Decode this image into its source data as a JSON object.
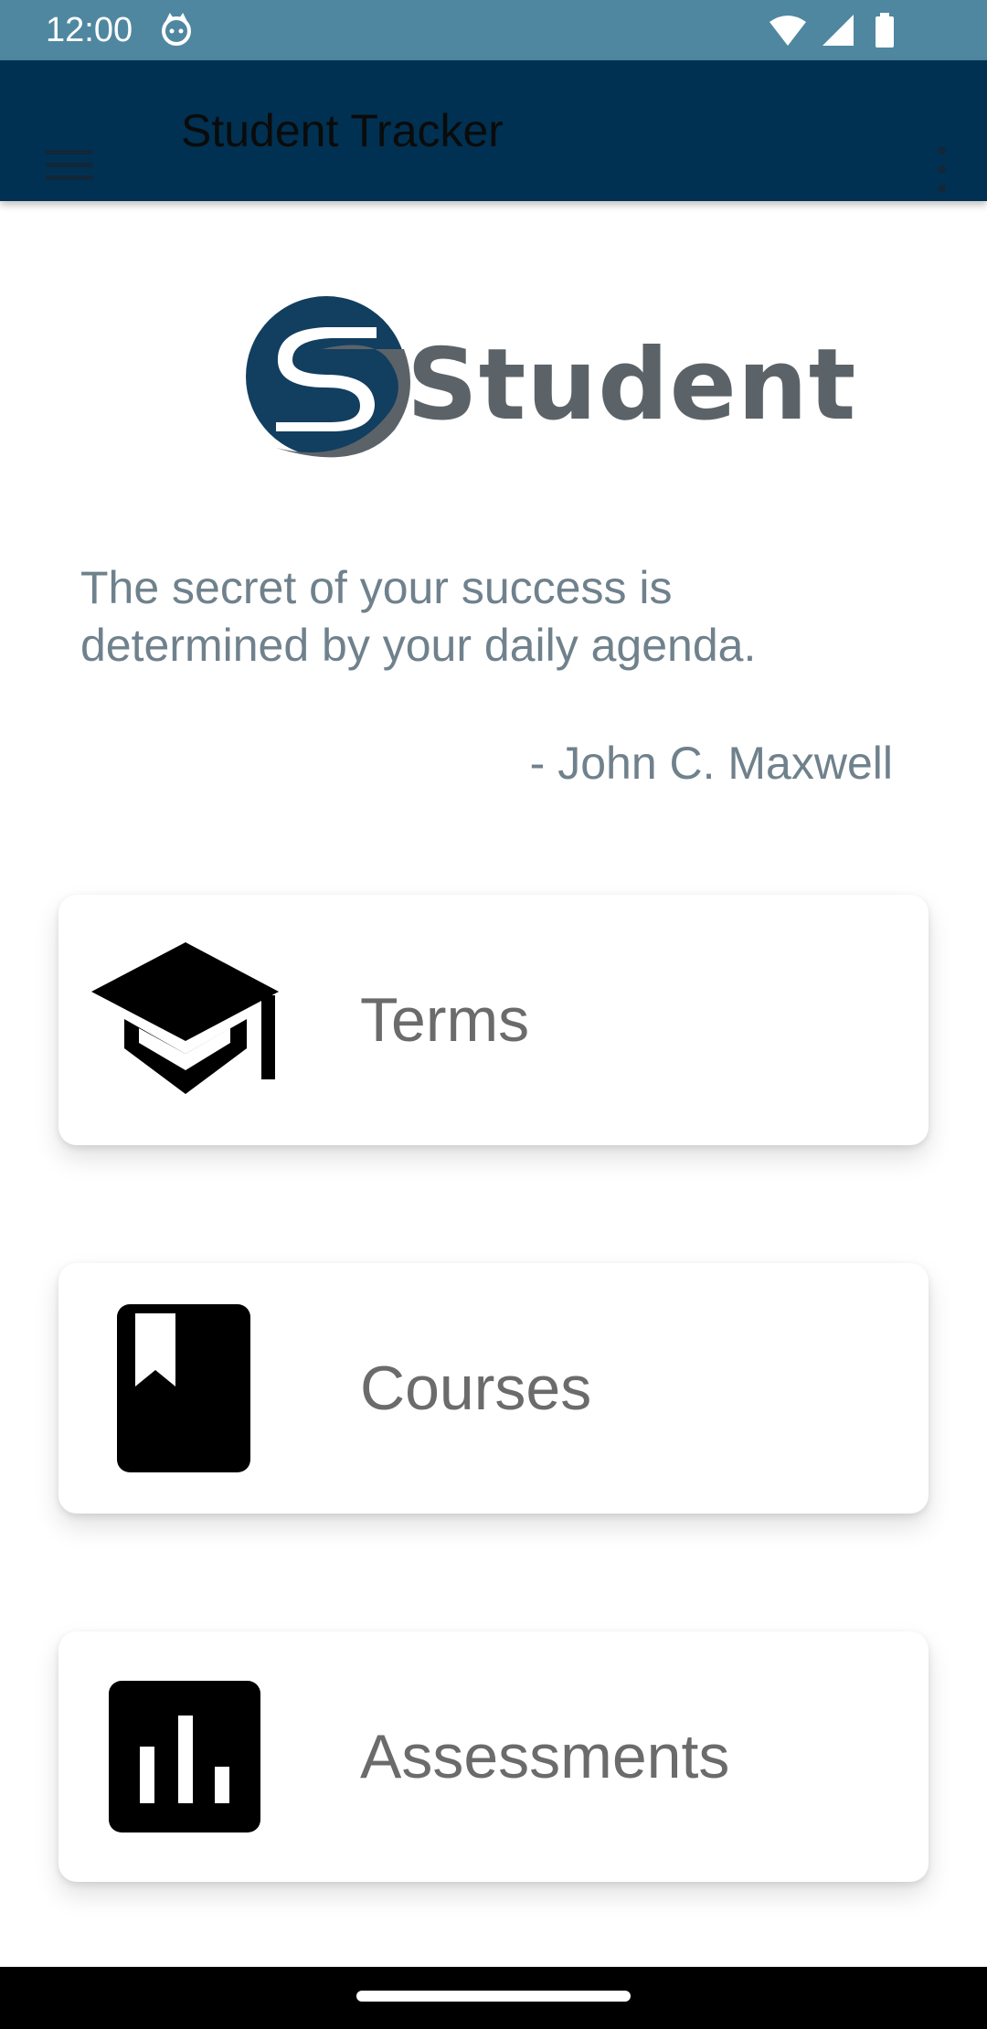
{
  "status_bar": {
    "time": "12:00",
    "app_icon": "cat-icon",
    "icons": [
      "wifi-icon",
      "cell-signal-icon",
      "battery-icon"
    ],
    "color": "#4f87a0"
  },
  "app_bar": {
    "title": "Student Tracker",
    "menu_icon": "hamburger-menu-icon",
    "overflow_icon": "more-vert-icon",
    "color": "#003152"
  },
  "logo": {
    "text": "Student",
    "colors": {
      "navy": "#123e60",
      "gray": "#5c6368"
    }
  },
  "quote": {
    "text": " The secret of your success is\ndetermined by your daily agenda.",
    "author": "- John C. Maxwell",
    "color": "#6f818c"
  },
  "menu_cards": [
    {
      "label": "Terms",
      "icon": "graduation-cap-icon"
    },
    {
      "label": "Courses",
      "icon": "book-icon"
    },
    {
      "label": "Assessments",
      "icon": "bar-chart-icon"
    }
  ],
  "nav_bar": {
    "handle": "home-handle"
  }
}
